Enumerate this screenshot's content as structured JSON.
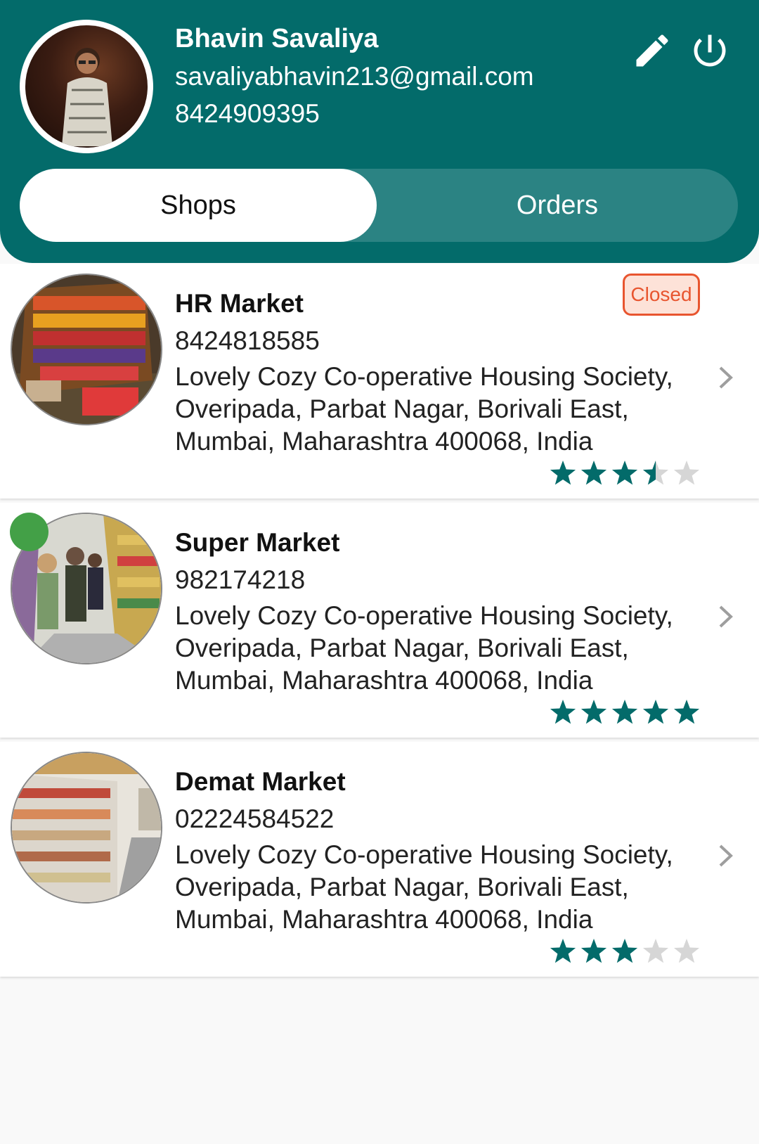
{
  "profile": {
    "name": "Bhavin Savaliya",
    "email": "savaliyabhavin213@gmail.com",
    "phone": "8424909395",
    "edit_icon": "pencil-icon",
    "logout_icon": "power-icon"
  },
  "tabs": [
    {
      "label": "Shops",
      "selected": true
    },
    {
      "label": "Orders",
      "selected": false
    }
  ],
  "colors": {
    "primary": "#036b6a",
    "tab_track": "#2b8383",
    "star_filled": "#036b6a",
    "star_empty": "#d6d6d6",
    "closed_badge": "#e8552f",
    "online": "#43a047"
  },
  "shops": [
    {
      "name": "HR Market",
      "phone": "8424818585",
      "address": "Lovely Cozy Co-operative Housing Society, Overipada, Parbat Nagar, Borivali East, Mumbai, Maharashtra 400068, India",
      "status": "Closed",
      "rating": 3.5
    },
    {
      "name": "Super Market",
      "phone": "982174218",
      "address": "Lovely Cozy Co-operative Housing Society, Overipada, Parbat Nagar, Borivali East, Mumbai, Maharashtra 400068, India",
      "online": true,
      "rating": 5
    },
    {
      "name": "Demat Market",
      "phone": "02224584522",
      "address": "Lovely Cozy Co-operative Housing Society, Overipada, Parbat Nagar, Borivali East, Mumbai, Maharashtra 400068, India",
      "rating": 3
    }
  ]
}
